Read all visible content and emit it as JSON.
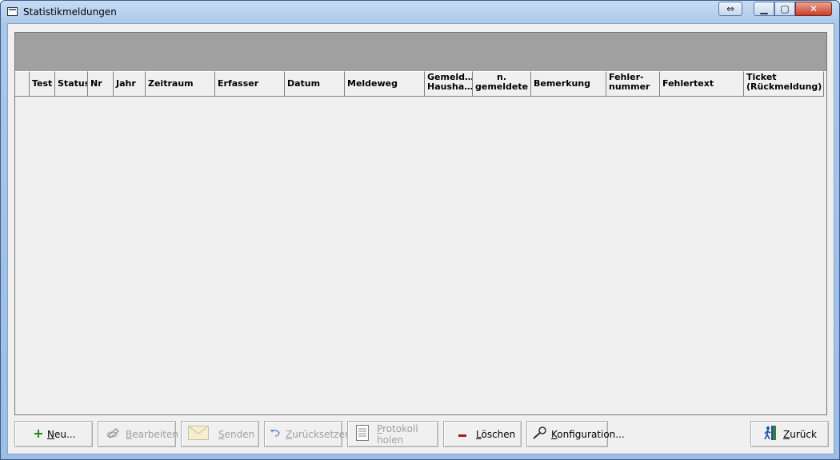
{
  "window": {
    "title": "Statistikmeldungen",
    "controls": {
      "resize": "⇔",
      "minimize": "▁",
      "maximize": "▢",
      "close": "✕"
    }
  },
  "grid": {
    "columns": [
      {
        "label": ""
      },
      {
        "label": "Test"
      },
      {
        "label": "Status"
      },
      {
        "label": "Nr"
      },
      {
        "label": "Jahr"
      },
      {
        "label": "Zeitraum"
      },
      {
        "label": "Erfasser"
      },
      {
        "label": "Datum"
      },
      {
        "label": "Meldeweg"
      },
      {
        "label": "Gemeld…\nHausha…"
      },
      {
        "label": "n.\ngemeldete"
      },
      {
        "label": "Bemerkung"
      },
      {
        "label": "Fehler-\nnummer"
      },
      {
        "label": "Fehlertext"
      },
      {
        "label": "Ticket\n(Rückmeldung)"
      }
    ],
    "rows": []
  },
  "buttons": {
    "neu": {
      "label": "Neu...",
      "icon": "plus-icon",
      "enabled": true
    },
    "bearbeiten": {
      "label": "Bearbeiten",
      "icon": "edit-pencil-icon",
      "enabled": false
    },
    "senden": {
      "label": "Senden",
      "icon": "envelope-icon",
      "enabled": false
    },
    "zuruecksetzen": {
      "label": "Zurücksetzen",
      "icon": "undo-arrow-icon",
      "enabled": false
    },
    "protokoll": {
      "label": "Protokoll holen",
      "icon": "document-icon",
      "enabled": false
    },
    "loeschen": {
      "label": "Löschen",
      "icon": "minus-icon",
      "enabled": true
    },
    "konfiguration": {
      "label": "Konfiguration...",
      "icon": "wrench-icon",
      "enabled": true
    },
    "zurueck": {
      "label": "Zurück",
      "icon": "exit-door-icon",
      "enabled": true
    }
  },
  "colors": {
    "plus": "#1a8f1a",
    "minus": "#b01818",
    "grid_band": "#a0a0a0"
  }
}
